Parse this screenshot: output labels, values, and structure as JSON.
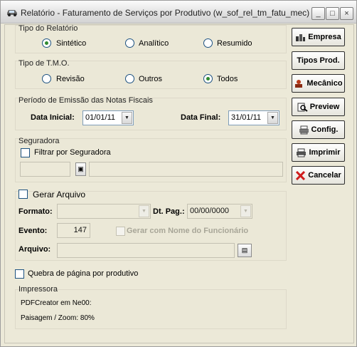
{
  "window": {
    "title": "Relatório - Faturamento de Serviços por Produtivo (w_sof_rel_tm_fatu_mec)",
    "minimize_glyph": "_",
    "maximize_glyph": "□",
    "close_glyph": "×"
  },
  "tipo_relatorio": {
    "title": "Tipo do Relatório",
    "options": [
      {
        "label": "Sintético",
        "selected": true
      },
      {
        "label": "Analítico",
        "selected": false
      },
      {
        "label": "Resumido",
        "selected": false
      }
    ]
  },
  "tipo_tmo": {
    "title": "Tipo de T.M.O.",
    "options": [
      {
        "label": "Revisão",
        "selected": false
      },
      {
        "label": "Outros",
        "selected": false
      },
      {
        "label": "Todos",
        "selected": true
      }
    ]
  },
  "periodo": {
    "title": "Período de Emissão das Notas Fiscais",
    "data_inicial_label": "Data Inicial:",
    "data_inicial": "01/01/11",
    "data_final_label": "Data Final:",
    "data_final": "31/01/11"
  },
  "seguradora": {
    "title": "Seguradora",
    "filtrar_label": "Filtrar por Seguradora",
    "filtrar_checked": false,
    "codigo": "",
    "nome": ""
  },
  "gerar_arquivo": {
    "label": "Gerar Arquivo",
    "checked": false,
    "formato_label": "Formato:",
    "formato_value": "",
    "dt_pag_label": "Dt. Pag.:",
    "dt_pag_value": "00/00/0000",
    "evento_label": "Evento:",
    "evento_value": "147",
    "gerar_nome_label": "Gerar com Nome do Funcionário",
    "arquivo_label": "Arquivo:",
    "arquivo_value": ""
  },
  "quebra": {
    "label": "Quebra de página por produtivo",
    "checked": false
  },
  "impressora": {
    "title": "Impressora",
    "printer": "PDFCreator em Ne00:",
    "settings": "Paisagem / Zoom: 80%"
  },
  "buttons": {
    "empresa": "Empresa",
    "tipos_prod": "Tipos Prod.",
    "mecanico": "Mecânico",
    "preview": "Preview",
    "config": "Config.",
    "imprimir": "Imprimir",
    "cancelar": "Cancelar"
  },
  "colors": {
    "window_bg": "#ece9d8",
    "radio_dot": "#2f8a2f",
    "cancel_x": "#d01c1c"
  }
}
